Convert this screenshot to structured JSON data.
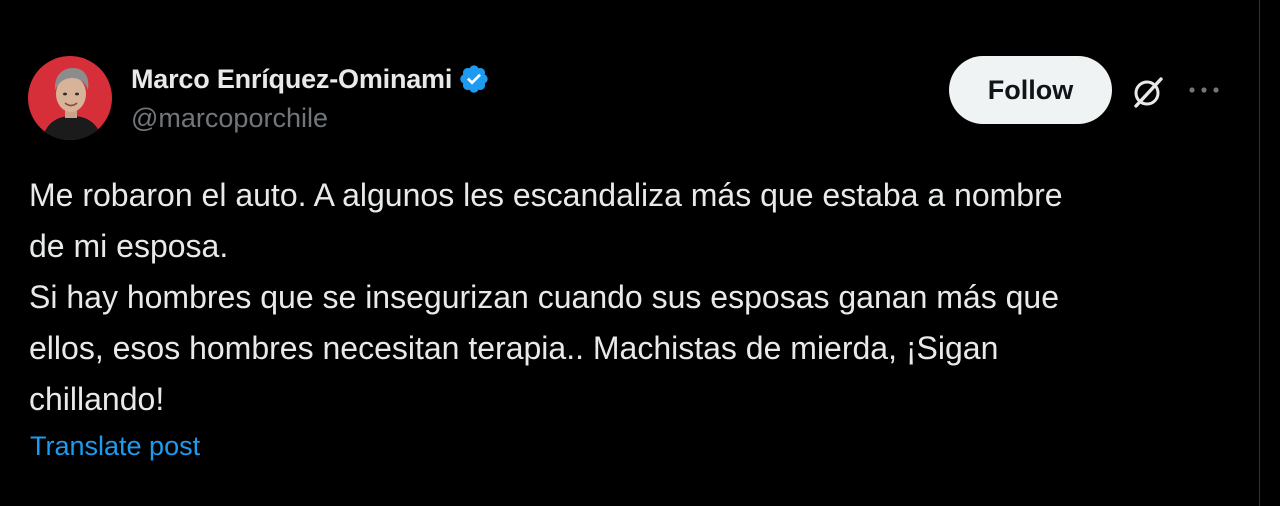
{
  "author": {
    "display_name": "Marco Enríquez-Ominami",
    "handle": "@marcoporchile",
    "verified": true,
    "verified_color": "#1d9bf0"
  },
  "actions": {
    "follow_label": "Follow",
    "grok_icon": "grok-icon",
    "more_icon": "more-options-icon"
  },
  "tweet": {
    "lines": [
      "Me robaron el auto. A algunos les escandaliza más que estaba a nombre",
      "de mi esposa.",
      "Si hay hombres que se insegurizan cuando sus esposas ganan más que",
      "ellos, esos hombres necesitan terapia.. Machistas de mierda, ¡Sigan",
      "chillando!"
    ]
  },
  "translate_label": "Translate post",
  "colors": {
    "background": "#000000",
    "text": "#e7e9ea",
    "muted": "#71767b",
    "link": "#1d9bf0",
    "button_bg": "#eff3f4",
    "button_text": "#0f1419",
    "avatar_ring": "#d62f3a"
  }
}
